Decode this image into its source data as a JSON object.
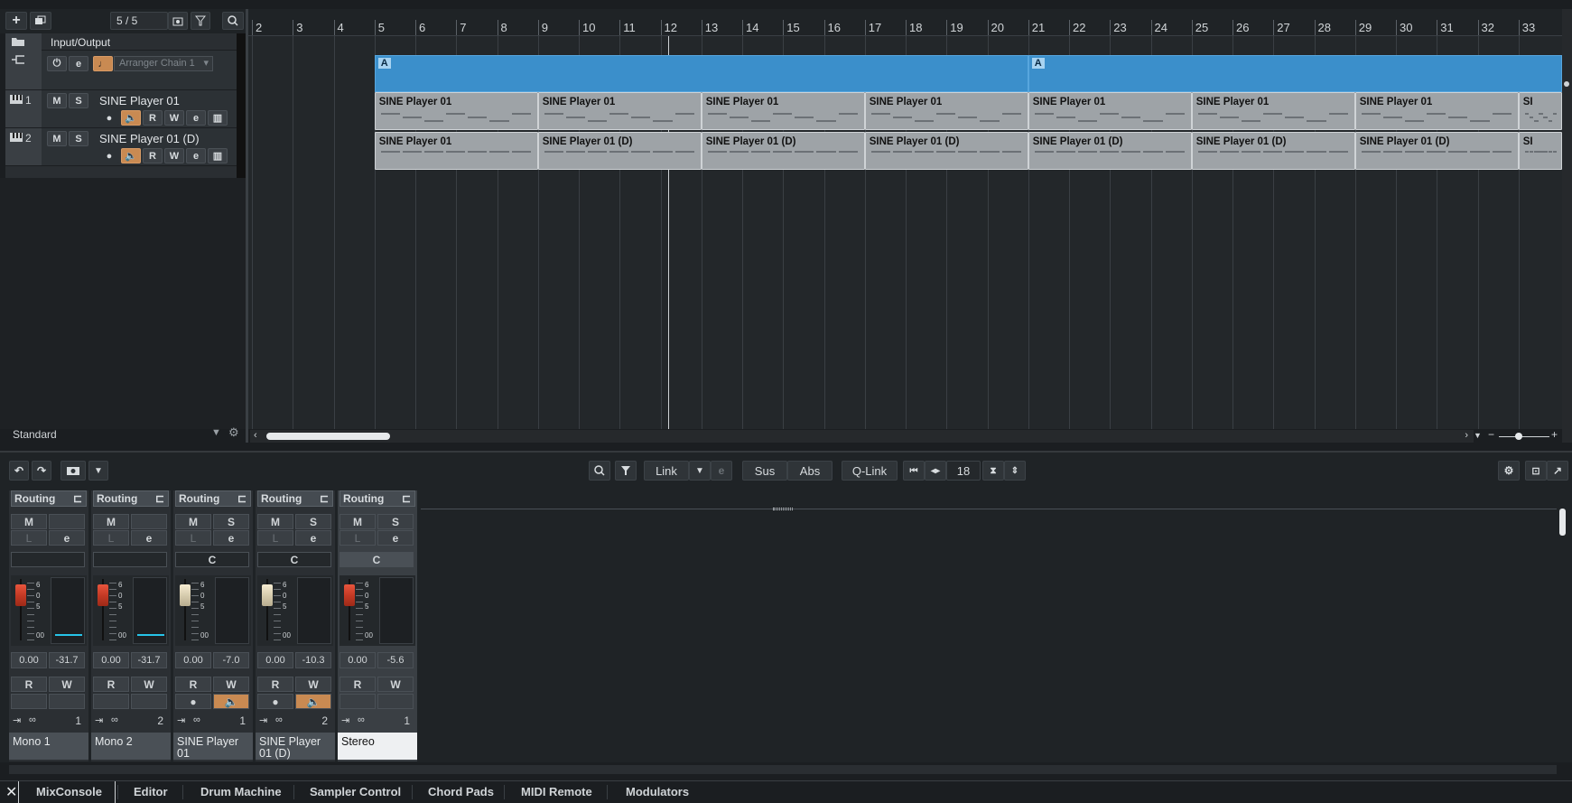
{
  "toolbar": {
    "counter": "5 / 5"
  },
  "global_track": {
    "label": "Input/Output"
  },
  "arranger_track": {
    "chain": "Arranger Chain 1"
  },
  "tracks": [
    {
      "num": "1",
      "name": "SINE Player 01"
    },
    {
      "num": "2",
      "name": "SINE Player 01 (D)"
    }
  ],
  "preset": "Standard",
  "ruler": {
    "bars": [
      "2",
      "3",
      "4",
      "5",
      "6",
      "7",
      "8",
      "9",
      "10",
      "11",
      "12",
      "13",
      "14",
      "15",
      "16",
      "17",
      "18",
      "19",
      "20",
      "21",
      "22",
      "23",
      "24",
      "25",
      "26",
      "27",
      "28",
      "29",
      "30",
      "31",
      "32",
      "33"
    ]
  },
  "arranger_events": [
    {
      "label": "A"
    },
    {
      "label": "A"
    }
  ],
  "lane1_events": [
    "SINE Player 01",
    "SINE Player 01",
    "SINE Player 01",
    "SINE Player 01",
    "SINE Player 01",
    "SINE Player 01",
    "SINE Player 01",
    "SI"
  ],
  "lane2_events": [
    "SINE Player 01",
    "SINE Player 01 (D)",
    "SINE Player 01 (D)",
    "SINE Player 01 (D)",
    "SINE Player 01 (D)",
    "SINE Player 01 (D)",
    "SINE Player 01 (D)",
    "SI"
  ],
  "mix_toolbar": {
    "link": "Link",
    "sus": "Sus",
    "abs": "Abs",
    "qlink": "Q-Link",
    "channels": "18"
  },
  "buttons": {
    "m": "M",
    "s": "S",
    "r": "R",
    "w": "W",
    "l": "L",
    "e": "e",
    "c": "C"
  },
  "strips": [
    {
      "routing": "Routing",
      "fader": "0.00",
      "meter": "-31.7",
      "index": "1",
      "name": "Mono 1"
    },
    {
      "routing": "Routing",
      "fader": "0.00",
      "meter": "-31.7",
      "index": "2",
      "name": "Mono 2"
    },
    {
      "routing": "Routing",
      "fader": "0.00",
      "meter": "-7.0",
      "index": "1",
      "name": "SINE Player 01"
    },
    {
      "routing": "Routing",
      "fader": "0.00",
      "meter": "-10.3",
      "index": "2",
      "name": "SINE Player 01 (D)"
    },
    {
      "routing": "Routing",
      "fader": "0.00",
      "meter": "-5.6",
      "index": "1",
      "name": "Stereo"
    }
  ],
  "fader_scale": {
    "t1": "6",
    "t2": "0",
    "t3": "5",
    "t4": "00"
  },
  "tabs": [
    "MixConsole",
    "Editor",
    "Drum Machine",
    "Sampler Control",
    "Chord Pads",
    "MIDI Remote",
    "Modulators"
  ],
  "colors": {
    "arranger": "#3b8fcb",
    "monitor_on": "#c98a52",
    "fader_red": "#e8553d",
    "meter_cyan": "#27c4e8"
  }
}
